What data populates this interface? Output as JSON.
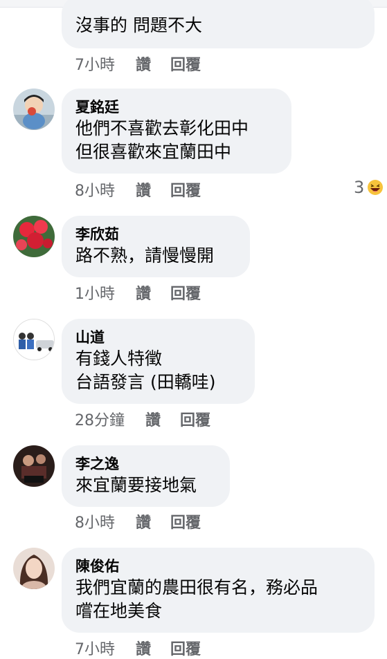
{
  "comments": [
    {
      "name": "",
      "lines": [
        "沒事的 問題不大"
      ],
      "time": "7小時",
      "like": "讚",
      "reply": "回覆"
    },
    {
      "name": "夏銘廷",
      "lines": [
        "他們不喜歡去彰化田中",
        "但很喜歡來宜蘭田中"
      ],
      "time": "8小時",
      "like": "讚",
      "reply": "回覆",
      "reaction_count": "3",
      "reaction_icon": "laughing-emoji-icon"
    },
    {
      "name": "李欣茹",
      "lines": [
        "路不熟，請慢慢開"
      ],
      "time": "1小時",
      "like": "讚",
      "reply": "回覆"
    },
    {
      "name": "山道",
      "lines": [
        "有錢人特徵",
        "台語發言 (田轎哇)"
      ],
      "time": "28分鐘",
      "like": "讚",
      "reply": "回覆"
    },
    {
      "name": "李之逸",
      "lines": [
        "來宜蘭要接地氣"
      ],
      "time": "8小時",
      "like": "讚",
      "reply": "回覆"
    },
    {
      "name": "陳俊佑",
      "lines": [
        "我們宜蘭的農田很有名，務必品",
        "嚐在地美食"
      ],
      "time": "7小時",
      "like": "讚",
      "reply": "回覆"
    }
  ],
  "colors": {
    "bubble": "#f0f2f5",
    "meta_text": "#65676b",
    "name_text": "#050505"
  }
}
